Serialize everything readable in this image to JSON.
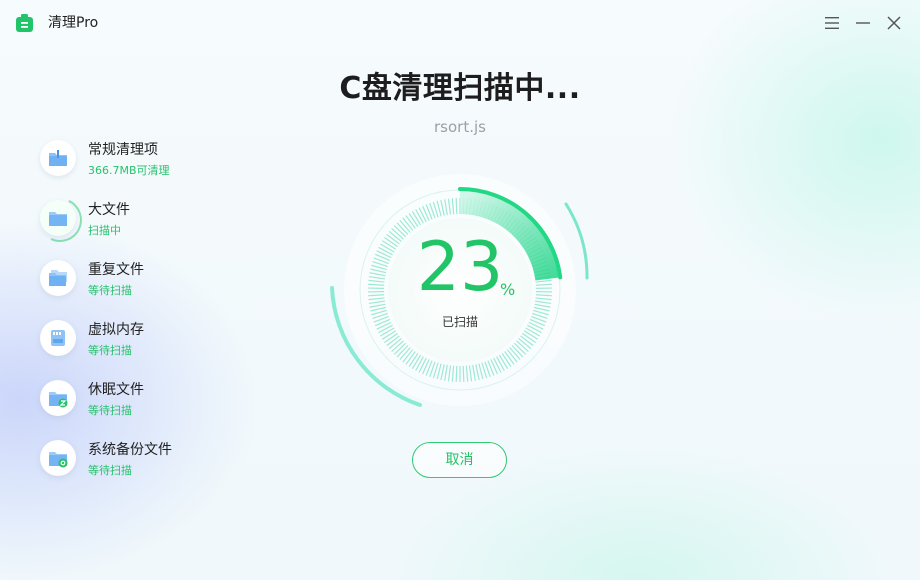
{
  "app": {
    "title": "清理Pro",
    "accent": "#21c467"
  },
  "window_controls": [
    "menu-icon",
    "minimize-icon",
    "close-icon"
  ],
  "heading": {
    "title": "C盘清理扫描中...",
    "current_file": "rsort.js"
  },
  "scan_items": [
    {
      "name": "常规清理项",
      "status": "366.7MB可清理",
      "icon": "broom-folder-icon",
      "state": "done"
    },
    {
      "name": "大文件",
      "status": "扫描中",
      "icon": "folder-icon",
      "state": "scanning"
    },
    {
      "name": "重复文件",
      "status": "等待扫描",
      "icon": "folder-copy-icon",
      "state": "waiting"
    },
    {
      "name": "虚拟内存",
      "status": "等待扫描",
      "icon": "memory-card-icon",
      "state": "waiting"
    },
    {
      "name": "休眠文件",
      "status": "等待扫描",
      "icon": "sleep-folder-icon",
      "state": "waiting"
    },
    {
      "name": "系统备份文件",
      "status": "等待扫描",
      "icon": "backup-folder-icon",
      "state": "waiting"
    }
  ],
  "progress": {
    "value": 23,
    "unit": "%",
    "label": "已扫描"
  },
  "actions": {
    "cancel": "取消"
  }
}
